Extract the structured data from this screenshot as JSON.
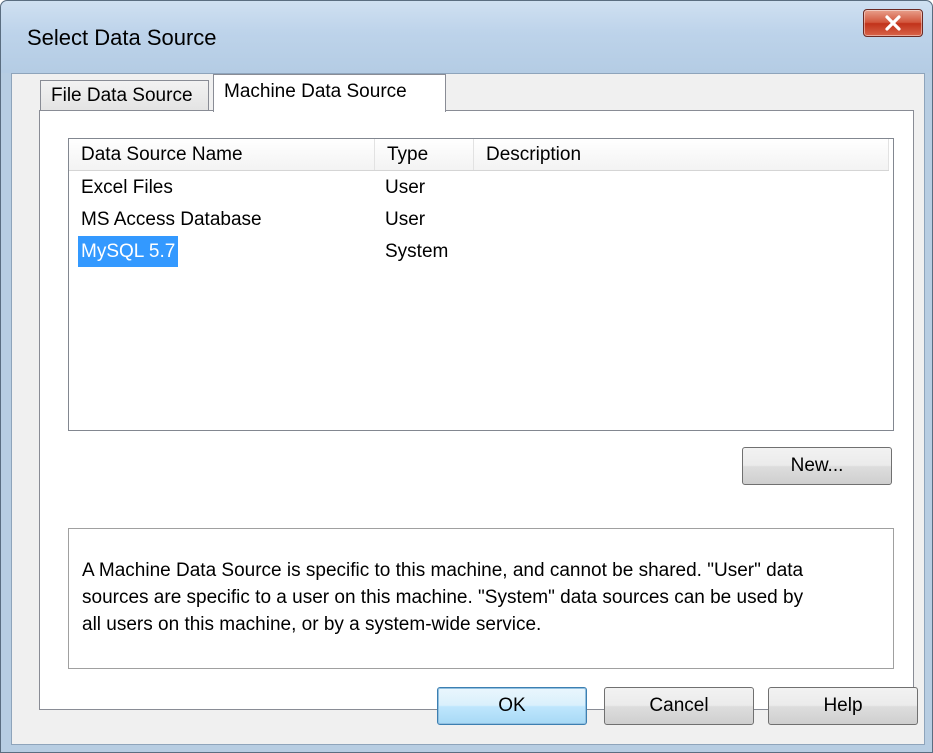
{
  "window": {
    "title": "Select Data Source"
  },
  "tabs": [
    {
      "label": "File Data Source",
      "active": false
    },
    {
      "label": "Machine Data Source",
      "active": true
    }
  ],
  "list": {
    "columns": [
      "Data Source Name",
      "Type",
      "Description"
    ],
    "rows": [
      {
        "name": "Excel Files",
        "type": "User",
        "description": ""
      },
      {
        "name": "MS Access Database",
        "type": "User",
        "description": ""
      },
      {
        "name": "MySQL 5.7",
        "type": "System",
        "description": "",
        "selected": true
      }
    ]
  },
  "buttons": {
    "new": "New...",
    "ok": "OK",
    "cancel": "Cancel",
    "help": "Help"
  },
  "description_text": "A Machine Data Source is specific to this machine, and cannot be shared.  \"User\" data\nsources are specific to a user on this machine.  \"System\" data sources can be used by\nall users on this machine, or by a system-wide service.",
  "colors": {
    "selection": "#3399ff",
    "titlebar": "#bdd3ea",
    "close_button": "#c1321a"
  }
}
